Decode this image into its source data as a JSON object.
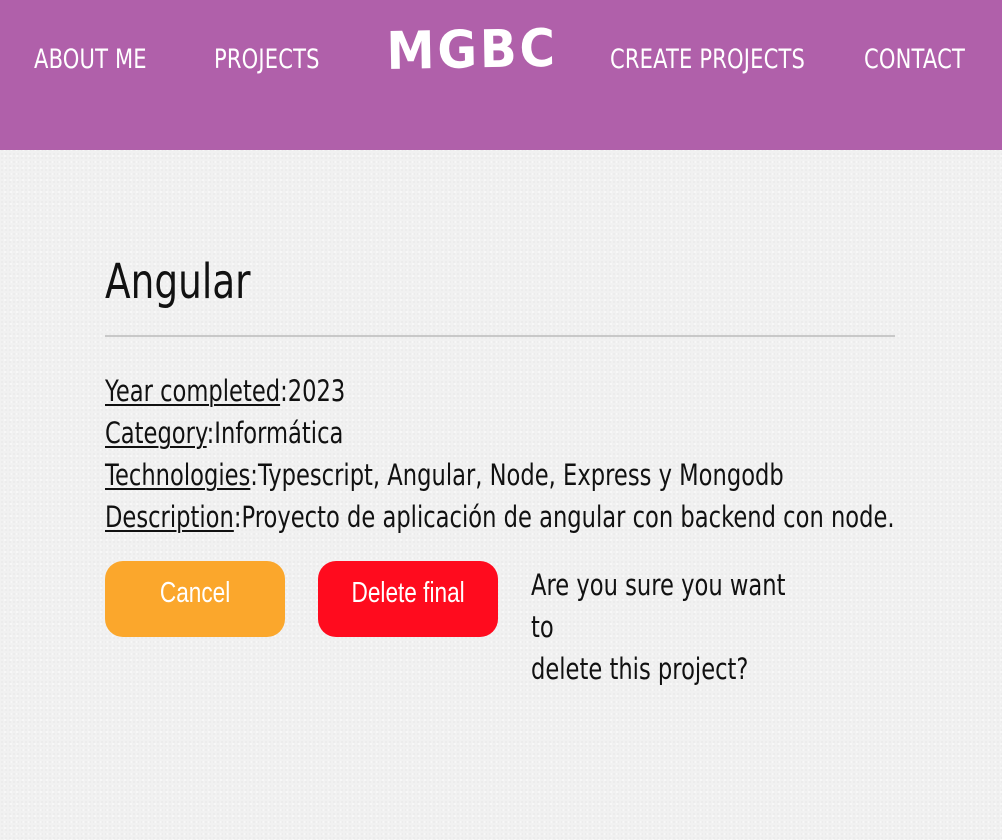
{
  "nav": {
    "about_label": "ABOUT ME",
    "projects_label": "PROJECTS",
    "logo_text": "MGBC",
    "create_label": "CREATE PROJECTS",
    "contact_label": "CONTACT"
  },
  "project": {
    "title": "Angular",
    "details": [
      {
        "key": "Year completed",
        "value": "2023"
      },
      {
        "key": "Category",
        "value": "Informática"
      },
      {
        "key": "Technologies",
        "value": "Typescript, Angular, Node, Express y Mongodb"
      },
      {
        "key": "Description",
        "value": "Proyecto de aplicación de angular con backend con node."
      }
    ]
  },
  "actions": {
    "cancel_label": "Cancel",
    "delete_label": "Delete final",
    "confirm_line1": "Are you sure you want to",
    "confirm_line2": "delete this project?"
  },
  "colors": {
    "header_bg": "#b060aa",
    "cancel_bg": "#fba72c",
    "delete_bg": "#ff0b1e"
  }
}
